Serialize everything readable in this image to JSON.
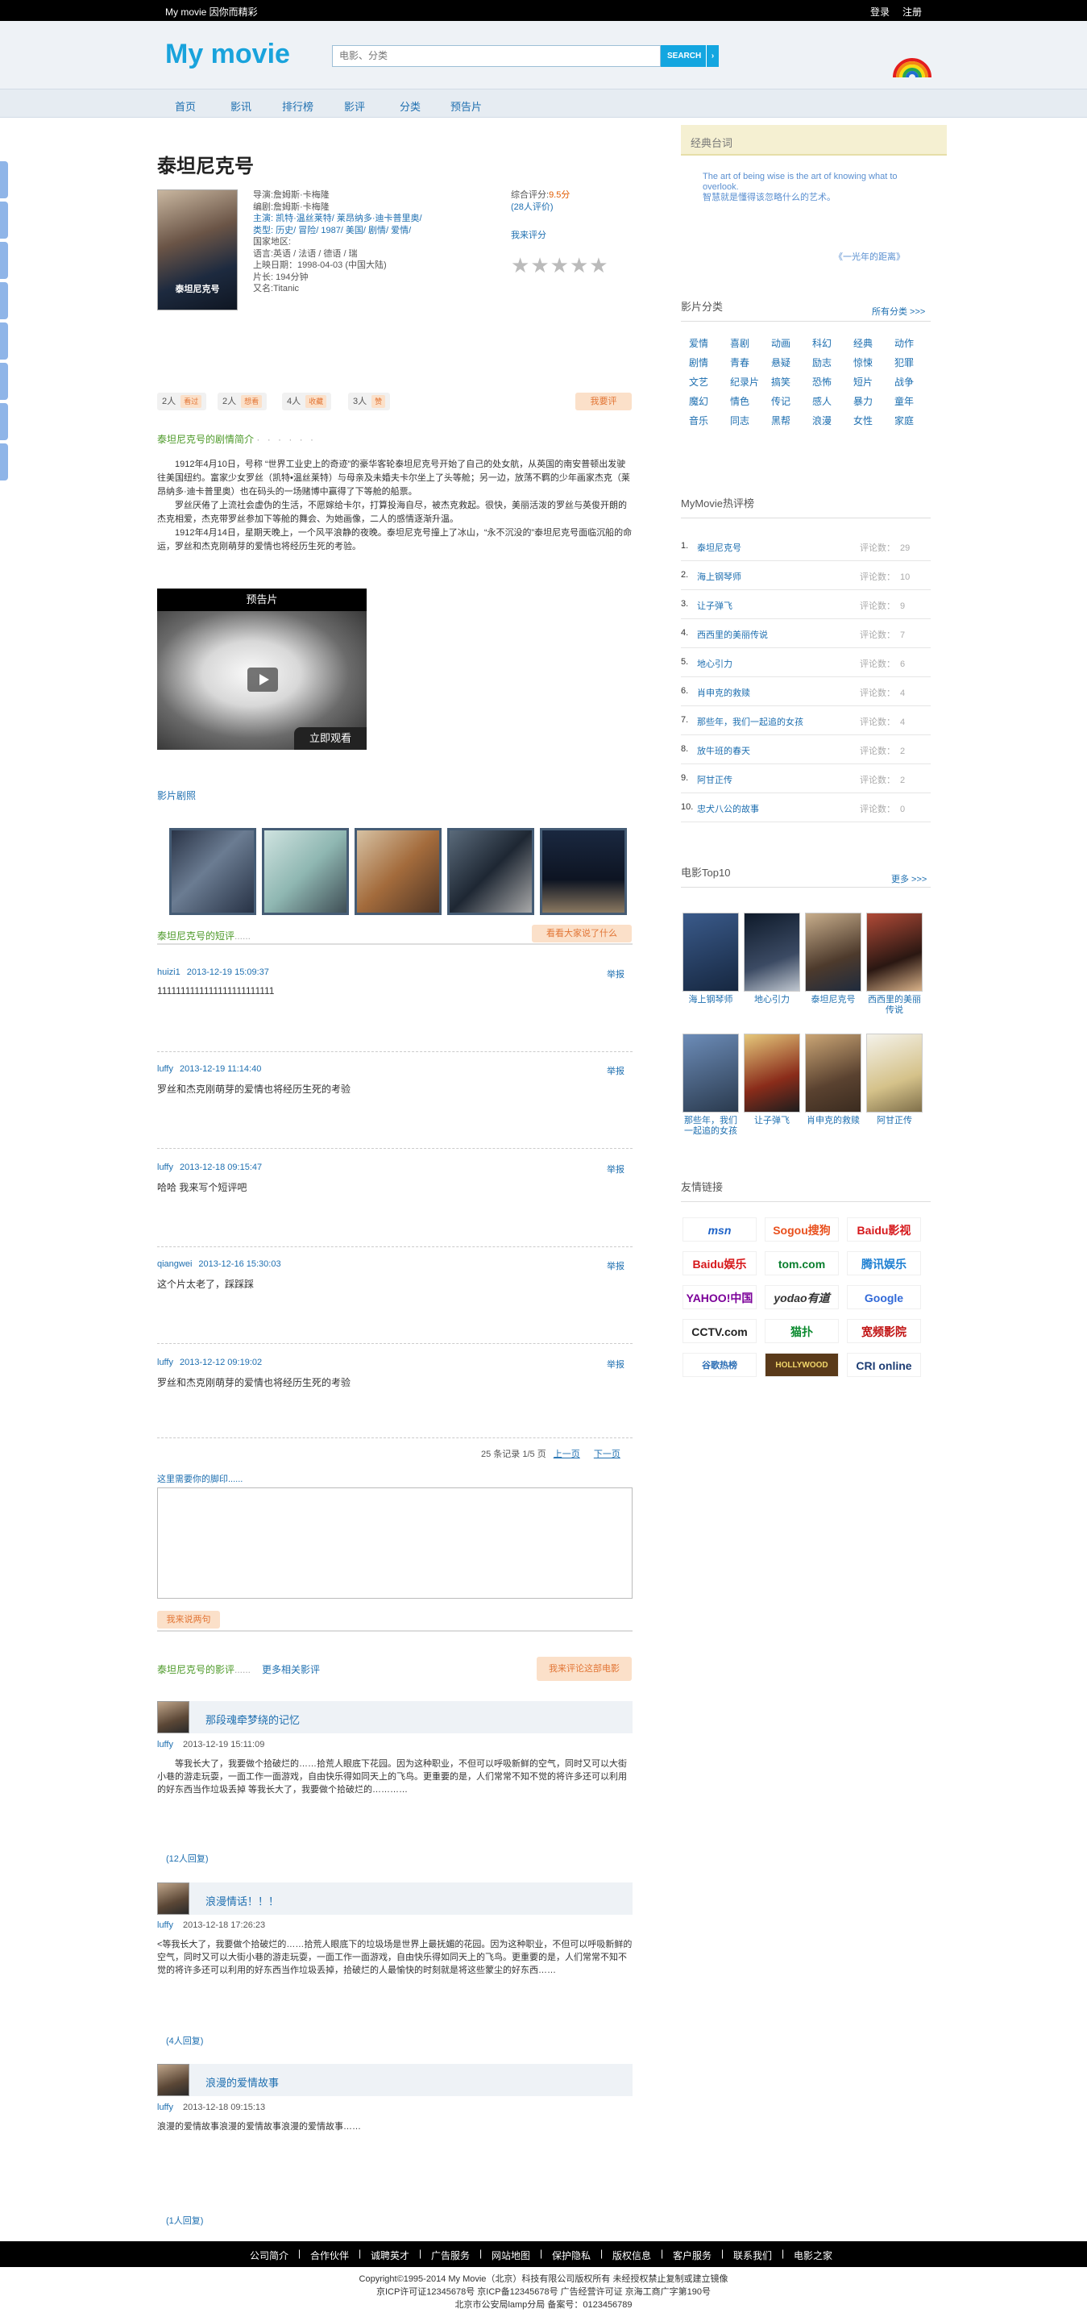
{
  "topbar": {
    "slogan": "My movie 因你而精彩",
    "login": "登录",
    "register": "注册"
  },
  "header": {
    "logo": "My movie",
    "search_placeholder": "电影、分类",
    "search_button": "SEARCH",
    "search_arrow": "›"
  },
  "nav": [
    "首页",
    "影讯",
    "排行榜",
    "影评",
    "分类",
    "预告片"
  ],
  "movie": {
    "title": "泰坦尼克号",
    "poster_title": "泰坦尼克号",
    "info": [
      "导演:詹姆斯·卡梅隆",
      "编剧:詹姆斯·卡梅隆",
      "主演: 凯特·温丝莱特/ 莱昂纳多·迪卡普里奥/",
      "类型: 历史/ 冒险/ 1987/ 美国/ 剧情/ 爱情/",
      "国家地区:",
      "语言:英语 / 法语 / 德语 / 瑞",
      "上映日期：1998-04-03 (中国大陆)",
      "片长: 194分钟",
      "又名:Titanic"
    ],
    "rating_label": "综合评分:",
    "rating_score": "9.5分",
    "rating_count": "(28人评价)",
    "my_rating": "我来评分",
    "stars": [
      "★",
      "★",
      "★",
      "★",
      "★"
    ]
  },
  "tags": [
    {
      "count": "2人",
      "label": "看过"
    },
    {
      "count": "2人",
      "label": "想看"
    },
    {
      "count": "4人",
      "label": "收藏"
    },
    {
      "count": "3人",
      "label": "赞"
    }
  ],
  "tag_button": "我要评",
  "synopsis": {
    "title": "泰坦尼克号的剧情简介",
    "dots": "· · · · · ·",
    "paragraphs": [
      "1912年4月10日，号称 “世界工业史上的奇迹”的豪华客轮泰坦尼克号开始了自己的处女航，从英国的南安普顿出发驶往美国纽约。富家少女罗丝（凯特•温丝莱特）与母亲及未婚夫卡尔坐上了头等舱；另一边，放荡不羁的少年画家杰克（莱昂纳多·迪卡普里奥）也在码头的一场赌博中赢得了下等舱的船票。",
      "罗丝厌倦了上流社会虚伪的生活，不愿嫁给卡尔，打算投海自尽，被杰克救起。很快，美丽活泼的罗丝与英俊开朗的杰克相爱，杰克带罗丝参加下等舱的舞会、为她画像，二人的感情逐渐升温。",
      "1912年4月14日，星期天晚上，一个风平浪静的夜晚。泰坦尼克号撞上了冰山，“永不沉没的”泰坦尼克号面临沉船的命运，罗丝和杰克刚萌芽的爱情也将经历生死的考验。"
    ]
  },
  "trailer": {
    "title": "预告片",
    "watch": "立即观看"
  },
  "stills_title": "影片剧照",
  "short_comments": {
    "title": "泰坦尼克号的短评",
    "dots": "......",
    "button": "看看大家说了什么",
    "report": "举报",
    "items": [
      {
        "user": "huizi1",
        "date": "2013-12-19 15:09:37",
        "text": "1111111111111111111111111"
      },
      {
        "user": "luffy",
        "date": "2013-12-19 11:14:40",
        "text": "罗丝和杰克刚萌芽的爱情也将经历生死的考验"
      },
      {
        "user": "luffy",
        "date": "2013-12-18 09:15:47",
        "text": "哈哈 我来写个短评吧"
      },
      {
        "user": "qiangwei",
        "date": "2013-12-16 15:30:03",
        "text": "这个片太老了，踩踩踩"
      },
      {
        "user": "luffy",
        "date": "2013-12-12 09:19:02",
        "text": "罗丝和杰克刚萌芽的爱情也将经历生死的考验"
      }
    ],
    "pager_info": "25 条记录 1/5 页",
    "prev": "上一页",
    "next": "下一页",
    "leave_label": "这里需要你的脚印......",
    "submit": "我来说两句"
  },
  "reviews": {
    "title": "泰坦尼克号的影评",
    "dots": "......",
    "more": "更多相关影评",
    "button": "我来评论这部电影",
    "items": [
      {
        "title": "那段魂牵梦绕的记忆",
        "user": "luffy",
        "date": "2013-12-19 15:11:09",
        "body": "等我长大了，我要做个拾破烂的……拾荒人眼底下花园。因为这种职业，不但可以呼吸新鲜的空气，同时又可以大街小巷的游走玩耍，一面工作一面游戏，自由快乐得如同天上的飞鸟。更重要的是，人们常常不知不觉的将许多还可以利用的好东西当作垃圾丢掉  等我长大了，我要做个拾破烂的…………",
        "replies": "(12人回复)"
      },
      {
        "title": "浪漫情话！！！",
        "user": "luffy",
        "date": "2013-12-18 17:26:23",
        "body": "<等我长大了，我要做个拾破烂的……拾荒人眼底下的垃圾场是世界上最抚媚的花园。因为这种职业，不但可以呼吸新鲜的空气，同时又可以大街小巷的游走玩耍，一面工作一面游戏，自由快乐得如同天上的飞鸟。更重要的是，人们常常不知不觉的将许多还可以利用的好东西当作垃圾丢掉，拾破烂的人最愉快的时刻就是将这些蒙尘的好东西……",
        "replies": "(4人回复)"
      },
      {
        "title": "浪漫的爱情故事",
        "user": "luffy",
        "date": "2013-12-18 09:15:13",
        "body": "浪漫的爱情故事浪漫的爱情故事浪漫的爱情故事……",
        "replies": "(1人回复)"
      }
    ]
  },
  "sidebar": {
    "quote_title": "经典台词",
    "quote_en": "The art of being wise is the art of knowing what to overlook.",
    "quote_zh": "智慧就是懂得该忽略什么的艺术。",
    "quote_source": "《一光年的距离》",
    "genres_title": "影片分类",
    "genres_more": "所有分类 >>>",
    "genres": [
      "爱情",
      "喜剧",
      "动画",
      "科幻",
      "经典",
      "动作",
      "剧情",
      "青春",
      "悬疑",
      "励志",
      "惊悚",
      "犯罪",
      "文艺",
      "纪录片",
      "搞笑",
      "恐怖",
      "短片",
      "战争",
      "魔幻",
      "情色",
      "传记",
      "感人",
      "暴力",
      "童年",
      "音乐",
      "同志",
      "黑帮",
      "浪漫",
      "女性",
      "家庭"
    ],
    "hot_title": "MyMovie热评榜",
    "hot_count_label": "评论数：",
    "hot": [
      {
        "n": "1.",
        "t": "泰坦尼克号",
        "c": "29"
      },
      {
        "n": "2.",
        "t": "海上钢琴师",
        "c": "10"
      },
      {
        "n": "3.",
        "t": "让子弹飞",
        "c": "9"
      },
      {
        "n": "4.",
        "t": "西西里的美丽传说",
        "c": "7"
      },
      {
        "n": "5.",
        "t": "地心引力",
        "c": "6"
      },
      {
        "n": "6.",
        "t": "肖申克的救赎",
        "c": "4"
      },
      {
        "n": "7.",
        "t": "那些年，我们一起追的女孩",
        "c": "4"
      },
      {
        "n": "8.",
        "t": "放牛班的春天",
        "c": "2"
      },
      {
        "n": "9.",
        "t": "阿甘正传",
        "c": "2"
      },
      {
        "n": "10.",
        "t": "忠犬八公的故事",
        "c": "0"
      }
    ],
    "top_title": "电影Top10",
    "top_more": "更多 >>>",
    "top": [
      "海上钢琴师",
      "地心引力",
      "泰坦尼克号",
      "西西里的美丽传说",
      "那些年，我们一起追的女孩",
      "让子弹飞",
      "肖申克的救赎",
      "阿甘正传"
    ],
    "links_title": "友情链接",
    "links": [
      "msn",
      "Sogou搜狗",
      "Baidu影视",
      "Baidu娱乐",
      "tom.com",
      "腾讯娱乐",
      "YAHOO!中国雅虎",
      "yodao有道",
      "Google",
      "CCTV.com",
      "猫扑",
      "宽频影院",
      "谷歌热榜",
      "HOLLYWOOD",
      "CRI online"
    ]
  },
  "footer": {
    "links": [
      "公司简介",
      "合作伙伴",
      "诚聘英才",
      "广告服务",
      "网站地图",
      "保护隐私",
      "版权信息",
      "客户服务",
      "联系我们",
      "电影之家"
    ],
    "copyright": "Copyright©1995-2014 My Movie（北京）科技有限公司版权所有 未经授权禁止复制或建立镜像",
    "icp": "京ICP许可证12345678号 京ICP备12345678号    广告经营许可证 京海工商广字第190号",
    "police": "北京市公安局lamp分局 备案号：0123456789"
  },
  "colors": {
    "accent": "#19a3dc",
    "link": "#1e6fb0",
    "green_title": "#4d9a29",
    "orange": "#e27535"
  }
}
